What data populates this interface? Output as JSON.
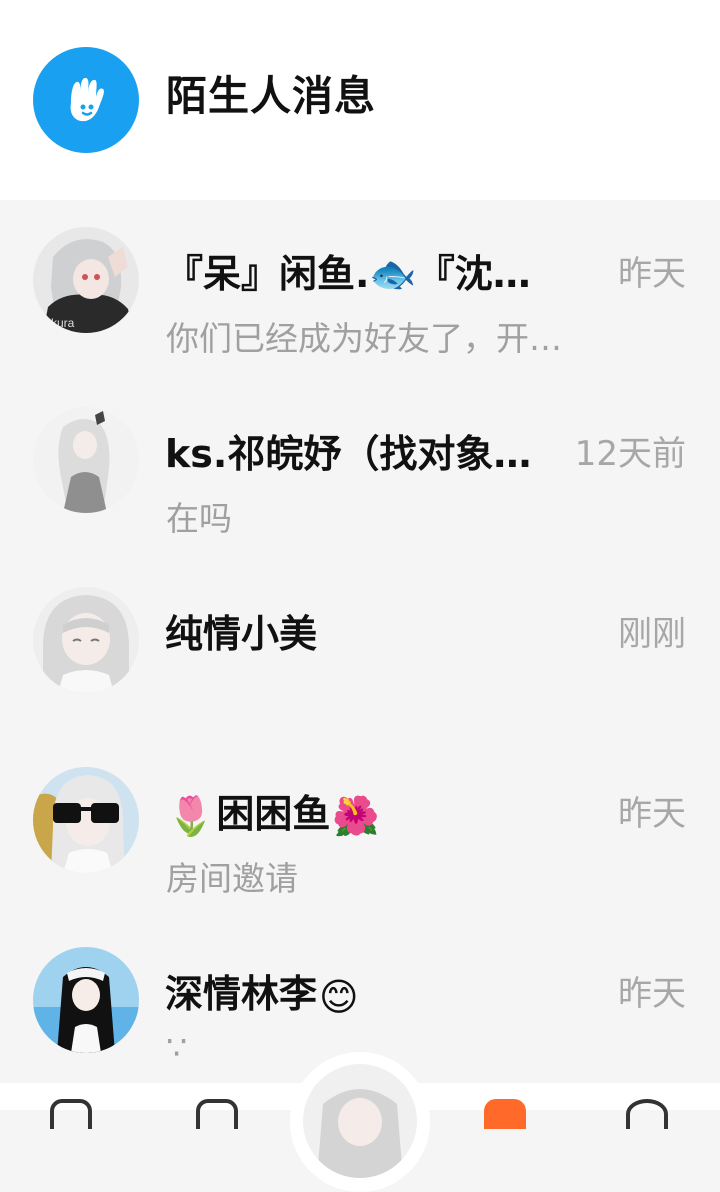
{
  "header": {
    "title": "陌生人消息",
    "icon": "hand-wave-icon",
    "icon_color": "#1aa0f0"
  },
  "conversations": [
    {
      "name": "『呆』闲鱼.🐟『沈…",
      "time": "昨天",
      "preview": "你们已经成为好友了，开…"
    },
    {
      "name": "ks.祁皖妤（找对象…",
      "time": "12天前",
      "preview": "在吗"
    },
    {
      "name": "纯情小美",
      "time": "刚刚",
      "preview": ""
    },
    {
      "name_parts": [
        "🌷",
        "困困鱼",
        "🌺"
      ],
      "time": "昨天",
      "preview": "房间邀请"
    },
    {
      "name_parts": [
        "",
        "深情林李",
        "😊"
      ],
      "time": "昨天",
      "preview": "∵"
    }
  ],
  "bottom_nav": {
    "items": [
      "home-icon",
      "message-icon",
      "profile-avatar",
      "live-icon",
      "me-icon"
    ],
    "accent_color": "#ff6a2a"
  }
}
